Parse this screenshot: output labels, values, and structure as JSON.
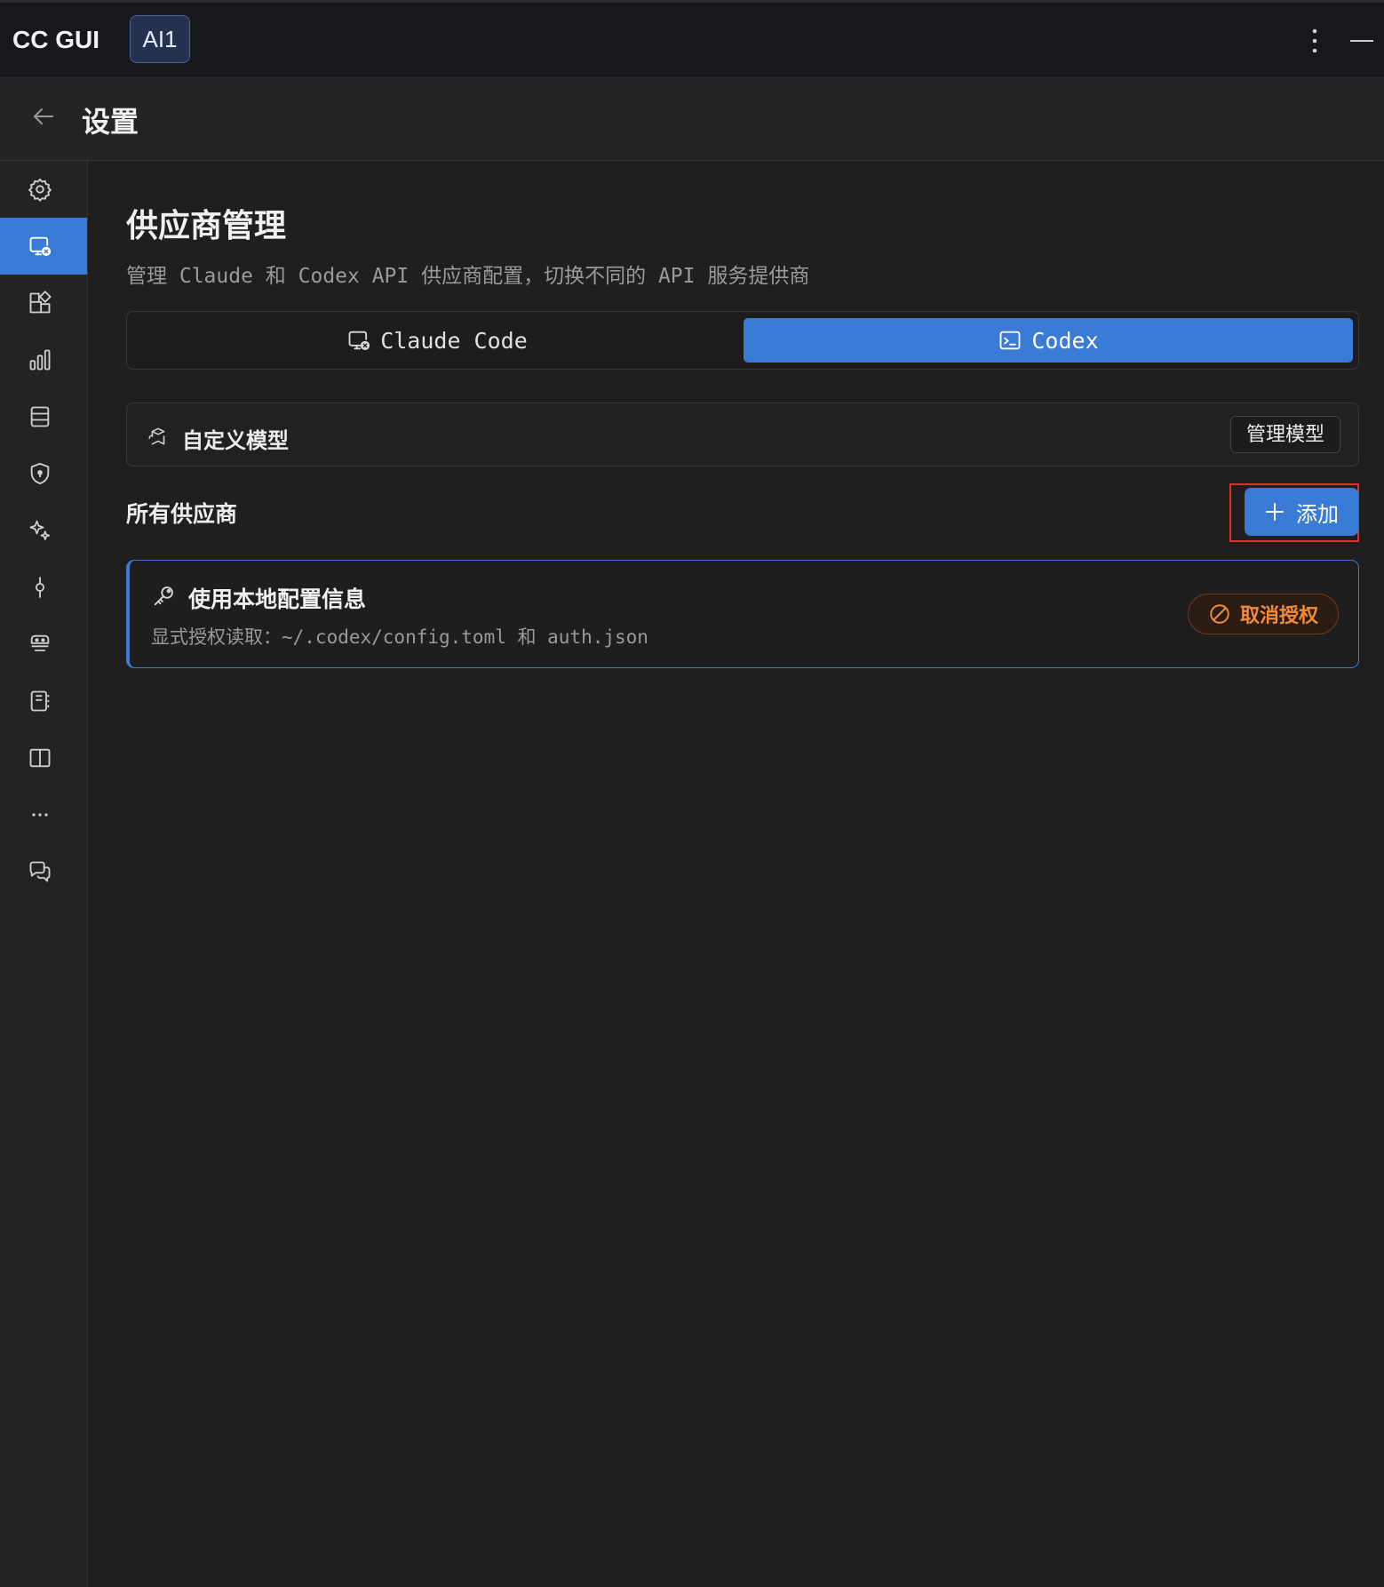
{
  "topbar": {
    "app_title": "CC GUI",
    "session_tab": "AI1",
    "icons": [
      "more-vertical-icon",
      "minimize-icon"
    ]
  },
  "header": {
    "title": "设置",
    "back_icon": "arrow-left-icon"
  },
  "sidebar": {
    "active_index": 1,
    "items": [
      {
        "icon": "gear-icon"
      },
      {
        "icon": "provider-icon"
      },
      {
        "icon": "grid-plus-icon"
      },
      {
        "icon": "bar-chart-icon"
      },
      {
        "icon": "database-icon"
      },
      {
        "icon": "shield-icon"
      },
      {
        "icon": "sparkle-icon"
      },
      {
        "icon": "commit-icon"
      },
      {
        "icon": "agent-icon"
      },
      {
        "icon": "notebook-icon"
      },
      {
        "icon": "book-open-icon"
      },
      {
        "icon": "ellipsis-icon"
      },
      {
        "icon": "chat-icon"
      }
    ],
    "accent_color": "#3a7bd5"
  },
  "main": {
    "title": "供应商管理",
    "subtitle": "管理 Claude 和 Codex API 供应商配置，切换不同的 API 服务提供商",
    "tabs": [
      {
        "label": "Claude Code",
        "icon": "provider-icon",
        "selected": false
      },
      {
        "label": "Codex",
        "icon": "terminal-icon",
        "selected": true
      }
    ],
    "custom_models": {
      "label": "自定义模型",
      "icon": "model-icon",
      "button": "管理模型"
    },
    "providers_section": {
      "label": "所有供应商",
      "add_button": "添加",
      "add_icon": "plus-icon"
    },
    "provider_card": {
      "name": "使用本地配置信息",
      "icon": "key-icon",
      "description": "显式授权读取：~/.codex/config.toml 和 auth.json",
      "revoke_button": "取消授权",
      "revoke_icon": "ban-icon",
      "revoke_color": "#f08a3a"
    }
  }
}
